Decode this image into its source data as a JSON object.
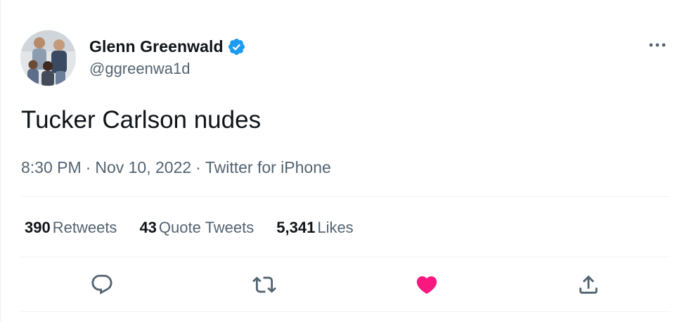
{
  "author": {
    "name": "Glenn Greenwald",
    "handle": "@ggreenwa1d",
    "verified": true
  },
  "tweet": {
    "text": "Tucker Carlson nudes",
    "time": "8:30 PM",
    "date": "Nov 10, 2022",
    "source": "Twitter for iPhone"
  },
  "meta_separator": "·",
  "stats": {
    "retweets_count": "390",
    "retweets_label": "Retweets",
    "quotes_count": "43",
    "quotes_label": "Quote Tweets",
    "likes_count": "5,341",
    "likes_label": "Likes"
  },
  "colors": {
    "verified": "#1d9bf0",
    "secondary_text": "#536471",
    "like_active": "#f91880",
    "divider": "#eff3f4"
  },
  "icons": {
    "more": "more-horizontal-icon",
    "reply": "reply-icon",
    "retweet": "retweet-icon",
    "like": "heart-filled-icon",
    "share": "share-icon"
  },
  "actions": {
    "liked": true
  }
}
